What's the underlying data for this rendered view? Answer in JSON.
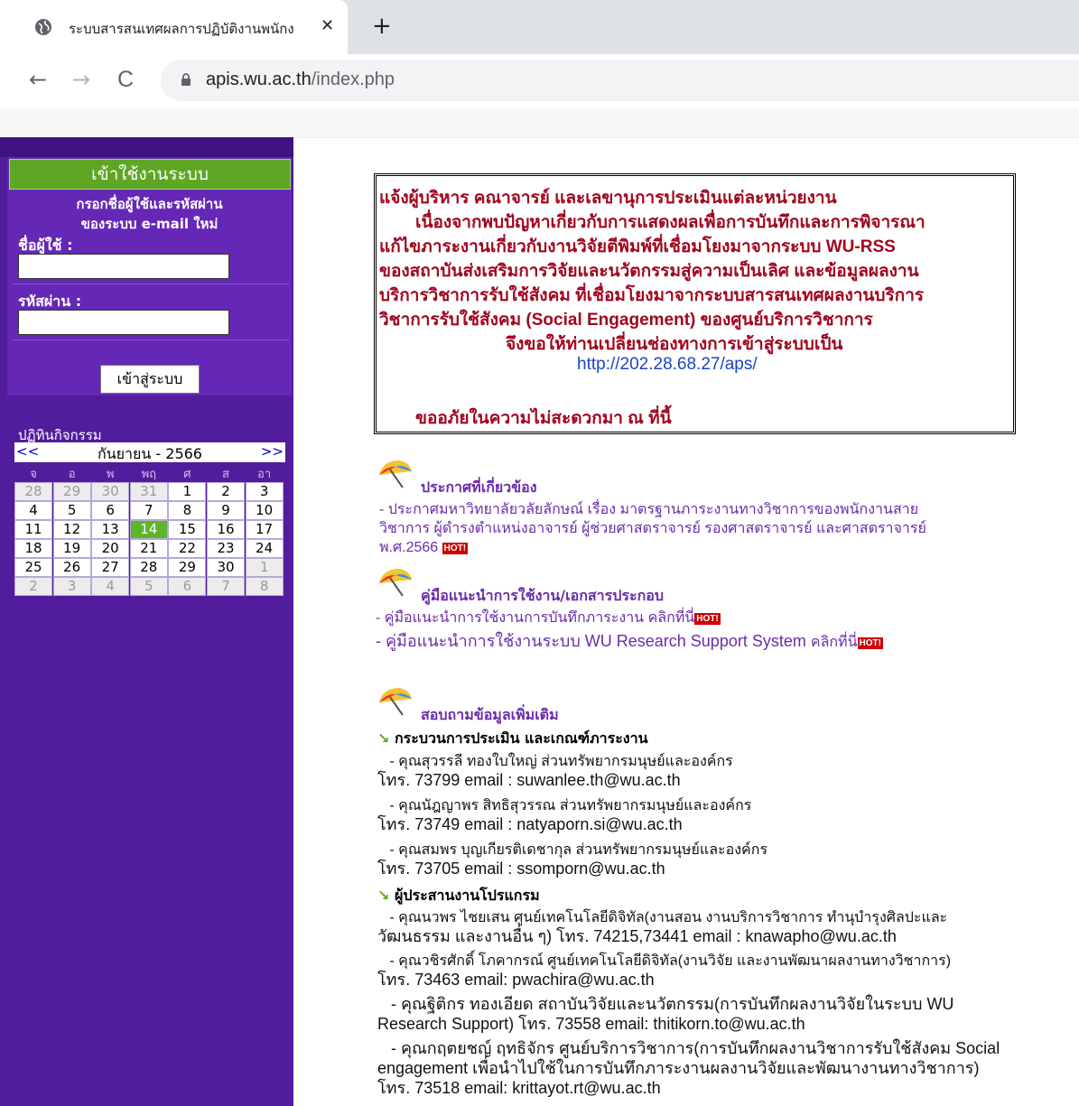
{
  "browser": {
    "tab_title": "ระบบสารสนเทศผลการปฏิบัติงานพนักง",
    "close_icon": "✕",
    "new_tab_icon": "+",
    "back_icon": "←",
    "forward_icon": "→",
    "reload_icon": "C",
    "url_host": "apis.wu.ac.th",
    "url_path": "/index.php"
  },
  "login": {
    "header": "เข้าใช้งานระบบ",
    "note_line1": "กรอกชื่อผู้ใช้และรหัสผ่าน",
    "note_line2": "ของระบบ e-mail ใหม่",
    "username_label": "ชื่อผู้ใช้ :",
    "password_label": "รหัสผ่าน :",
    "submit_label": "เข้าสู่ระบบ"
  },
  "calendar": {
    "title": "ปฏิทินกิจกรรม",
    "prev": "<<",
    "next": ">>",
    "month_label": "กันยายน - 2566",
    "weekdays": [
      "จ",
      "อ",
      "พ",
      "พฤ",
      "ศ",
      "ส",
      "อา"
    ],
    "weeks": [
      [
        {
          "d": "28",
          "o": true
        },
        {
          "d": "29",
          "o": true
        },
        {
          "d": "30",
          "o": true
        },
        {
          "d": "31",
          "o": true
        },
        {
          "d": "1"
        },
        {
          "d": "2"
        },
        {
          "d": "3"
        }
      ],
      [
        {
          "d": "4"
        },
        {
          "d": "5"
        },
        {
          "d": "6"
        },
        {
          "d": "7"
        },
        {
          "d": "8"
        },
        {
          "d": "9"
        },
        {
          "d": "10"
        }
      ],
      [
        {
          "d": "11"
        },
        {
          "d": "12"
        },
        {
          "d": "13"
        },
        {
          "d": "14",
          "t": true
        },
        {
          "d": "15"
        },
        {
          "d": "16"
        },
        {
          "d": "17"
        }
      ],
      [
        {
          "d": "18"
        },
        {
          "d": "19"
        },
        {
          "d": "20"
        },
        {
          "d": "21"
        },
        {
          "d": "22"
        },
        {
          "d": "23"
        },
        {
          "d": "24"
        }
      ],
      [
        {
          "d": "25"
        },
        {
          "d": "26"
        },
        {
          "d": "27"
        },
        {
          "d": "28"
        },
        {
          "d": "29"
        },
        {
          "d": "30"
        },
        {
          "d": "1",
          "o": true
        }
      ],
      [
        {
          "d": "2",
          "o": true
        },
        {
          "d": "3",
          "o": true
        },
        {
          "d": "4",
          "o": true
        },
        {
          "d": "5",
          "o": true
        },
        {
          "d": "6",
          "o": true
        },
        {
          "d": "7",
          "o": true
        },
        {
          "d": "8",
          "o": true
        }
      ]
    ]
  },
  "notice": {
    "line1": "แจ้งผู้บริหาร คณาจารย์ และเลขานุการประเมินแต่ละหน่วยงาน",
    "line2": "เนื่องจากพบปัญหาเกี่ยวกับการแสดงผลเพื่อการบันทึกและการพิจารณา",
    "line3": "แก้ไขภาระงานเกี่ยวกับงานวิจัยตีพิมพ์ที่เชื่อมโยงมาจากระบบ WU-RSS",
    "line4": "ของสถาบันส่งเสริมการวิจัยและนวัตกรรมสู่ความเป็นเลิศ และข้อมูลผลงาน",
    "line5": "บริการวิชาการรับใช้สังคม ที่เชื่อมโยงมาจากระบบสารสนเทศผลงานบริการ",
    "line6": "วิชาการรับใช้สังคม (Social Engagement) ของศูนย์บริการวิชาการ",
    "line7": "จึงขอให้ท่านเปลี่ยนช่องทางการเข้าสู่ระบบเป็น",
    "link": "http://202.28.68.27/aps/",
    "apology": "ขออภัยในความไม่สะดวกมา ณ ที่นี้"
  },
  "announcements": {
    "title": "ประกาศที่เกี่ยวข้อง",
    "line1": "- ประกาศมหาวิทยาลัยวลัยลักษณ์ เรื่อง มาตรฐานภาระงานทางวิชาการของพนักงานสาย",
    "line2": "วิชาการ ผู้ดำรงตำแหน่งอาจารย์ ผู้ช่วยศาสตราจารย์ รองศาสตราจารย์ และศาสตราจารย์",
    "line3": "พ.ศ.2566",
    "hot": "HOT!"
  },
  "manuals": {
    "title": "คู่มือแนะนำการใช้งาน/เอกสารประกอบ",
    "item1_text": "- คู่มือแนะนำการใช้งานการบันทึกภาระงาน ",
    "item1_link": "คลิกที่นี่",
    "item2_text": "- คู่มือแนะนำการใช้งานระบบ WU Research Support System ",
    "item2_link": "คลิกที่นี่",
    "hot": "HOT!"
  },
  "contact": {
    "title": "สอบถามข้อมูลเพิ่มเติม",
    "group1": "กระบวนการประเมิน และเกณฑ์ภาระงาน",
    "p1a": "   - คุณสุวรรลี ทองใบใหญ่ ส่วนทรัพยากรมนุษย์และองค์กร",
    "p1b": "โทร. 73799 email : suwanlee.th@wu.ac.th",
    "p2a": "   - คุณนัฎญาพร สิทธิสุวรรณ ส่วนทรัพยากรมนุษย์และองค์กร",
    "p2b": "โทร. 73749 email : natyaporn.si@wu.ac.th",
    "p3a": "   - คุณสมพร บุญเกียรติเดชากุล ส่วนทรัพยากรมนุษย์และองค์กร",
    "p3b": "โทร. 73705 email : ssomporn@wu.ac.th",
    "group2": "ผู้ประสานงานโปรแกรม",
    "q1a": "   - คุณนวพร ไชยเสน ศูนย์เทคโนโลยีดิจิทัล(งานสอน งานบริการวิชาการ ทำนุบำรุงศิลปะและ",
    "q1b": "วัฒนธรรม และงานอื่น ๆ) โทร. 74215,73441 email : knawapho@wu.ac.th",
    "q2a": "   - คุณวชิรศักดิ์ โภคากรณ์ ศูนย์เทคโนโลยีดิจิทัล(งานวิจัย และงานพัฒนาผลงานทางวิชาการ)",
    "q2b": "โทร. 73463 email: pwachira@wu.ac.th",
    "q3a": "   - คุณฐิติกร ทองเอียด สถาบันวิจัยและนวัตกรรม(การบันทึกผลงานวิจัยในระบบ WU",
    "q3b": "Research Support) โทร. 73558 email: thitikorn.to@wu.ac.th",
    "q4a": "   - คุณกฤตยชญ์ ฤทธิจักร ศูนย์บริการวิชาการ(การบันทึกผลงานวิชาการรับใช้สังคม Social",
    "q4b": "engagement เพื่อนำไปใช้ในการบันทึกภาระงานผลงานวิจัยและพัฒนางานทางวิชาการ)",
    "q4c": "โทร. 73518 email: krittayot.rt@wu.ac.th"
  }
}
